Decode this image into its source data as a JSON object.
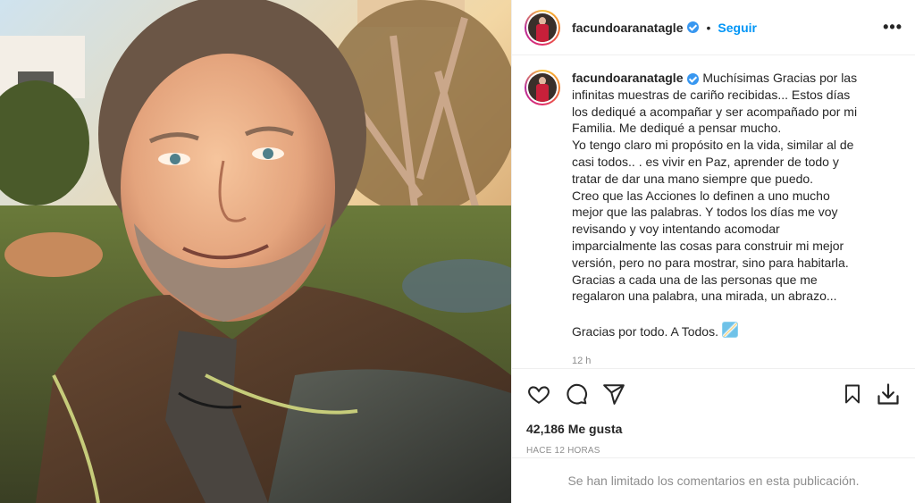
{
  "post": {
    "username": "facundoaranatagle",
    "follow_label": "Seguir",
    "separator": "•",
    "more_label": "•••",
    "caption_lines": [
      "Muchísimas Gracias por las",
      "infinitas muestras de cariño recibidas... Estos días",
      "los dediqué a acompañar y ser acompañado por mi",
      "Familia. Me dediqué a pensar mucho.",
      "Yo tengo claro mi propósito en la vida, similar al de",
      "casi todos.. . es vivir en Paz, aprender de todo y",
      "tratar de dar una mano siempre que puedo.",
      "Creo que las Acciones lo definen a uno mucho",
      "mejor que las palabras. Y todos los días me voy",
      "revisando y voy intentando acomodar",
      "imparcialmente las cosas para construir mi mejor",
      "versión, pero no para mostrar, sino para habitarla.",
      "Gracias a cada una de las personas que me",
      "regalaron una palabra, una mirada, un abrazo...",
      "",
      "Gracias por todo. A Todos."
    ],
    "caption_time": "12 h",
    "likes": "42,186 Me gusta",
    "posted_ago": "HACE 12 HORAS",
    "comments_notice": "Se han limitado los comentarios en esta publicación."
  },
  "icons": {
    "like": "heart-icon",
    "comment": "comment-icon",
    "share": "share-icon",
    "save": "bookmark-icon",
    "download": "download-icon",
    "verified": "verified-badge-icon"
  },
  "colors": {
    "link": "#0095f6",
    "text": "#262626",
    "muted": "#8e8e8e",
    "verified": "#3897f0"
  }
}
